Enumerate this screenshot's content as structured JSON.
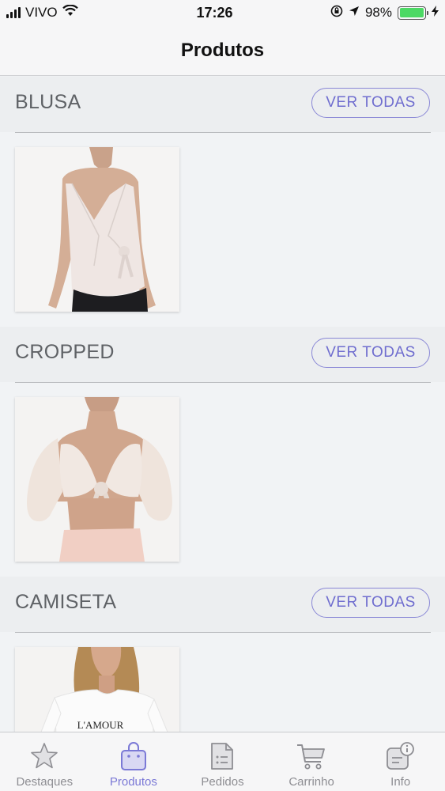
{
  "status_bar": {
    "carrier": "VIVO",
    "time": "17:26",
    "battery": "98%",
    "battery_level": 0.98,
    "battery_color": "#4cd964"
  },
  "nav": {
    "title": "Produtos"
  },
  "accent_color": "#7b79d6",
  "sections": [
    {
      "title": "BLUSA",
      "button": "VER TODAS",
      "product_image": "white wrap blouse"
    },
    {
      "title": "CROPPED",
      "button": "VER TODAS",
      "product_image": "cream tie-front cropped top"
    },
    {
      "title": "CAMISETA",
      "button": "VER TODAS",
      "product_image": "white graphic t-shirt",
      "product_print": "L'AMOUR"
    }
  ],
  "tabs": [
    {
      "label": "Destaques",
      "icon": "star-icon",
      "active": false
    },
    {
      "label": "Produtos",
      "icon": "shopping-bag-icon",
      "active": true
    },
    {
      "label": "Pedidos",
      "icon": "document-icon",
      "active": false
    },
    {
      "label": "Carrinho",
      "icon": "cart-icon",
      "active": false
    },
    {
      "label": "Info",
      "icon": "info-icon",
      "active": false
    }
  ]
}
